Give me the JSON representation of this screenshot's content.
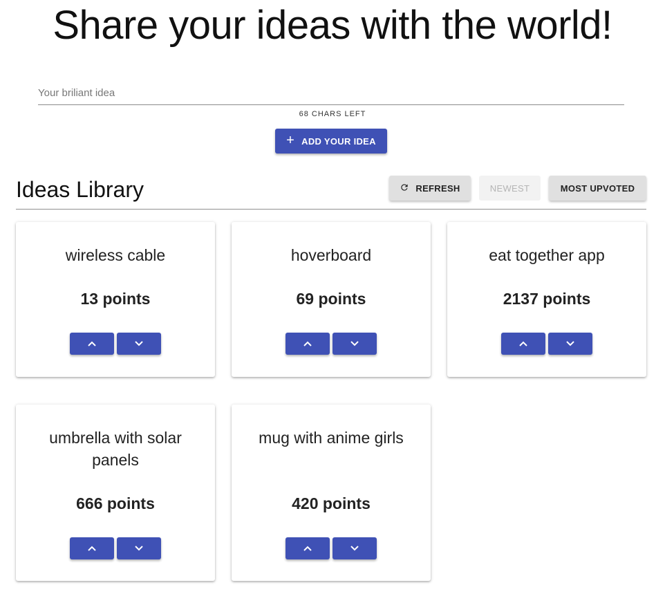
{
  "hero": {
    "title": "Share your ideas with the world!"
  },
  "form": {
    "placeholder": "Your briliant idea",
    "chars_left": "68 CHARS LEFT",
    "add_label": "ADD YOUR IDEA",
    "add_icon": "plus-icon"
  },
  "library": {
    "title": "Ideas Library",
    "refresh_label": "REFRESH",
    "refresh_icon": "refresh-icon",
    "newest_label": "NEWEST",
    "most_upvoted_label": "MOST UPVOTED"
  },
  "ideas": [
    {
      "title": "wireless cable",
      "points": "13 points"
    },
    {
      "title": "hoverboard",
      "points": "69 points"
    },
    {
      "title": "eat together app",
      "points": "2137 points"
    },
    {
      "title": "umbrella with solar panels",
      "points": "666 points"
    },
    {
      "title": "mug with anime girls",
      "points": "420 points"
    }
  ],
  "colors": {
    "primary": "#3f51b5",
    "button_grey": "#e0e0e0",
    "disabled_text": "#b5b5b5"
  }
}
